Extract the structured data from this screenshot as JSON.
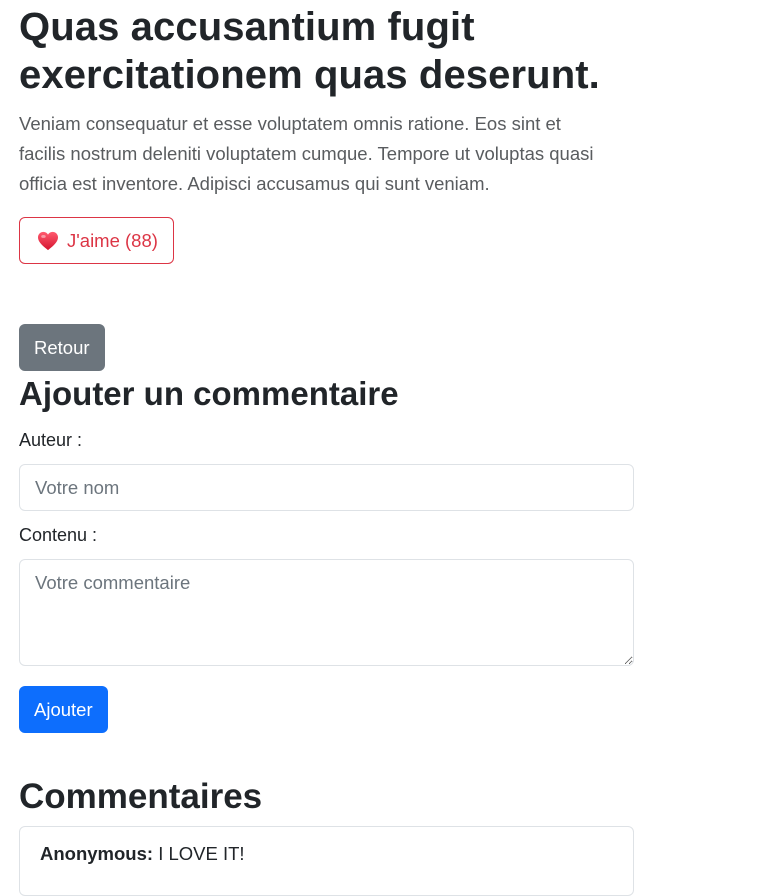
{
  "post": {
    "title": "Quas accusantium fugit exercitationem quas deserunt.",
    "body": "Veniam consequatur et esse voluptatem omnis ratione. Eos sint et facilis nostrum deleniti voluptatem cumque. Tempore ut voluptas quasi officia est inventore. Adipisci accusamus qui sunt veniam.",
    "like_label": "J'aime (88)",
    "like_icon": "heart-icon",
    "like_color": "#dc3545"
  },
  "nav": {
    "back_label": "Retour",
    "back_color": "#6c757d"
  },
  "comment_form": {
    "title": "Ajouter un commentaire",
    "author_label": "Auteur :",
    "author_placeholder": "Votre nom",
    "author_value": "",
    "content_label": "Contenu :",
    "content_placeholder": "Votre commentaire",
    "content_value": "",
    "submit_label": "Ajouter",
    "submit_color": "#0d6efd"
  },
  "comments": {
    "title": "Commentaires",
    "items": [
      {
        "author": "Anonymous:",
        "text": " I LOVE IT!"
      }
    ]
  }
}
